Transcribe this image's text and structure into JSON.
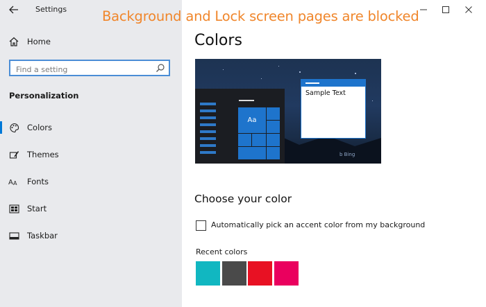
{
  "window": {
    "title": "Settings",
    "controls": {
      "minimize": "–",
      "maximize": "☐",
      "close": "✕"
    }
  },
  "overlay_banner": "Background and Lock screen pages are blocked",
  "sidebar": {
    "home_label": "Home",
    "search_placeholder": "Find a setting",
    "section_heading": "Personalization",
    "items": [
      {
        "label": "Colors",
        "icon": "palette-icon",
        "active": true
      },
      {
        "label": "Themes",
        "icon": "paintbrush-icon",
        "active": false
      },
      {
        "label": "Fonts",
        "icon": "fonts-icon",
        "active": false
      },
      {
        "label": "Start",
        "icon": "start-icon",
        "active": false
      },
      {
        "label": "Taskbar",
        "icon": "taskbar-icon",
        "active": false
      }
    ]
  },
  "main": {
    "page_title": "Colors",
    "preview": {
      "tile_label": "Aa",
      "sample_text": "Sample Text",
      "bing_mark": "b Bing"
    },
    "choose_title": "Choose your color",
    "auto_accent_label": "Automatically pick an accent color from my background",
    "auto_accent_checked": false,
    "recent_colors_label": "Recent colors",
    "recent_colors": [
      "#11b7c1",
      "#4a4a4a",
      "#e81123",
      "#ea005e"
    ]
  },
  "colors": {
    "accent": "#0078d7",
    "sidebar_bg": "#e9eaed",
    "banner": "#f0862b"
  }
}
